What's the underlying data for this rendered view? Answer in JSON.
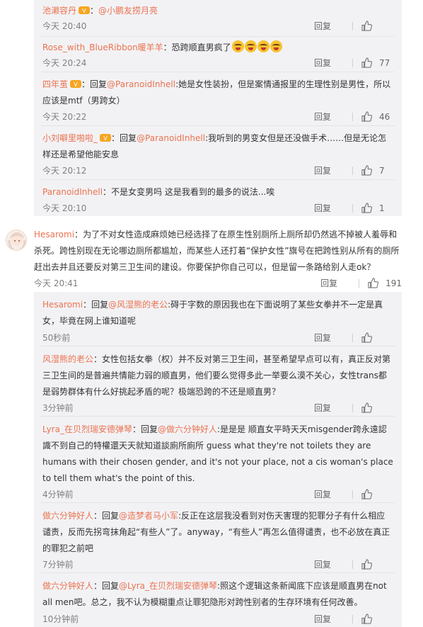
{
  "icons": {
    "reply": "comment-reply",
    "like": "thumbs-up-icon",
    "badge": "member-badge-icon",
    "emoji": "crying-laughing-emoji"
  },
  "colors": {
    "username": "#eb7350",
    "reply_bg": "#f2f2f5",
    "text": "#333333",
    "time": "#808080"
  },
  "labels": {
    "reply": "回复",
    "reply_prefix": "回复"
  },
  "replies_top": [
    {
      "user": "池濑容丹",
      "badge": true,
      "sep": "：",
      "mention": "@小鹏友捞月亮",
      "text": "",
      "time": "今天 20:40",
      "likes": ""
    },
    {
      "user": "Rose_with_BlueRibbon暖羊羊",
      "badge": false,
      "sep": "：",
      "mention": "",
      "text": "恐跨顺直男疯了",
      "emojis": 4,
      "time": "今天 20:24",
      "likes": "77"
    },
    {
      "user": "四年茧",
      "badge": true,
      "sep": "：",
      "prefix": "回复",
      "mention": "@ParanoidInhell",
      "text": ":她是女性装扮，但是案情通报里的生理性别是男性，所以应该是mtf（男跨女）",
      "time": "今天 20:22",
      "likes": "46"
    },
    {
      "user": "小刘噼里啪啦_",
      "badge": true,
      "sep": "：",
      "prefix": "回复",
      "mention": "@ParanoidInhell",
      "text": ":我听到的男变女但是还没做手术……但是无论怎样还是希望他能安息",
      "time": "今天 20:12",
      "likes": "7"
    },
    {
      "user": "ParanoidInhell",
      "badge": false,
      "sep": "：",
      "mention": "",
      "text": "不是女变男吗 这是我看到的最多的说法...唉",
      "time": "今天 20:10",
      "likes": "1"
    }
  ],
  "main_comment": {
    "user": "Hesaromi",
    "sep": "：",
    "text": "为了不对女性造成麻烦她已经选择了在原生性别厕所上厕所却仍然逃不掉被人羞辱和杀死。跨性别现在无论哪边厕所都尴尬，而某些人还打着“保护女性”旗号在把跨性别从所有的厕所赶出去并且还要反对第三卫生间的建设。你要保护你自己可以，但是留一条路给别人走ok？",
    "time": "今天 20:41",
    "likes": "191"
  },
  "replies_bottom": [
    {
      "user": "Hesaromi",
      "sep": "：",
      "prefix": "回复",
      "mention": "@风湿熊的老公",
      "text": ":碍于字数的原因我也在下面说明了某些女拳并不一定是真女，毕竟在网上谁知道呢",
      "time": "50秒前",
      "likes": ""
    },
    {
      "user": "风湿熊的老公",
      "sep": "：",
      "prefix": "",
      "mention": "",
      "text": "女性包括女拳（权）并不反对第三卫生间，甚至希望早点可以有，真正反对第三卫生间的是普遍共情能力弱的顺直男，他们要么觉得多此一举要么漠不关心，女性trans都是弱势群体有什么好挑起矛盾的呢？极端恐跨的不还是顺直男？",
      "time": "3分钟前",
      "likes": ""
    },
    {
      "user": "Lyra_在贝烈瑞安德弹琴",
      "sep": "：",
      "prefix": "回复",
      "mention": "@做六分钟好人",
      "text": ":是是是 顺直女平時天天misgender跨永遠認識不到自己的特權還天天就知道談廁所廁所 guess what they're not toilets they are humans with their chosen gender, and it's not your place, not a cis woman's place to tell them what's the point of this.",
      "time": "4分钟前",
      "likes": ""
    },
    {
      "user": "做六分钟好人",
      "sep": "：",
      "prefix": "回复",
      "mention": "@造梦者马小军",
      "text": ":反正在这层我没看到对伤天害理的犯罪分子有什么相应谴责，反而先拐弯抹角起“有些人”了。anyway，“有些人”再怎么值得谴责，也不必放在真正的罪犯之前吧",
      "time": "7分钟前",
      "likes": ""
    },
    {
      "user": "做六分钟好人",
      "sep": "：",
      "prefix": "回复",
      "mention": "@Lyra_在贝烈瑞安德弹琴",
      "text": ":照这个逻辑这条新闻底下应该是顺直男在not all men吧。总之，我不认为模糊重点让罪犯隐形对跨性别者的生存环境有任何改善。",
      "time": "10分钟前",
      "likes": ""
    }
  ]
}
